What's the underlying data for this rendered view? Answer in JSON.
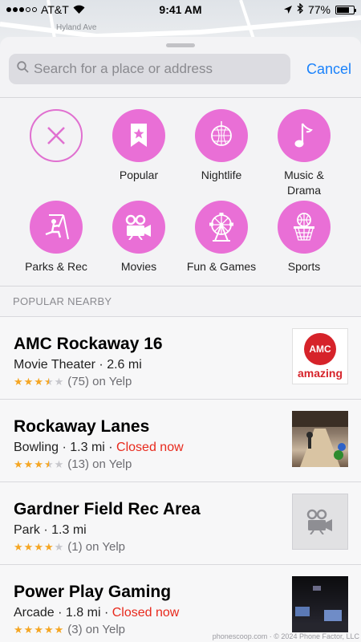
{
  "status": {
    "carrier": "AT&T",
    "time": "9:41 AM",
    "battery": "77%",
    "battery_level": 0.77
  },
  "map": {
    "street_label": "Hyland Ave"
  },
  "search": {
    "placeholder": "Search for a place or address",
    "cancel_label": "Cancel"
  },
  "categories": [
    {
      "label": "",
      "icon": "close-icon"
    },
    {
      "label": "Popular",
      "icon": "bookmark-star-icon"
    },
    {
      "label": "Nightlife",
      "icon": "disco-ball-icon"
    },
    {
      "label": "Music &\nDrama",
      "icon": "music-note-icon"
    },
    {
      "label": "Parks & Rec",
      "icon": "swing-icon"
    },
    {
      "label": "Movies",
      "icon": "film-camera-icon"
    },
    {
      "label": "Fun & Games",
      "icon": "ferris-wheel-icon"
    },
    {
      "label": "Sports",
      "icon": "basketball-hoop-icon"
    }
  ],
  "section": {
    "title": "POPULAR NEARBY"
  },
  "places": [
    {
      "name": "AMC Rockaway 16",
      "type": "Movie Theater",
      "distance": "2.6 mi",
      "status": "",
      "stars": 3.5,
      "reviews": "(75) on Yelp",
      "thumb": {
        "logo": "amc",
        "tagline": "amazing"
      }
    },
    {
      "name": "Rockaway Lanes",
      "type": "Bowling",
      "distance": "1.3 mi",
      "status": "Closed now",
      "stars": 3.5,
      "reviews": "(13) on Yelp",
      "thumb": {
        "kind": "photo"
      }
    },
    {
      "name": "Gardner Field Rec Area",
      "type": "Park",
      "distance": "1.3 mi",
      "status": "",
      "stars": 4,
      "reviews": "(1) on Yelp",
      "thumb": {
        "kind": "placeholder-film-camera"
      }
    },
    {
      "name": "Power Play Gaming",
      "type": "Arcade",
      "distance": "1.8 mi",
      "status": "Closed now",
      "stars": 5,
      "reviews": "(3) on Yelp",
      "thumb": {
        "kind": "photo"
      }
    }
  ],
  "colors": {
    "accent": "#1a82fb",
    "category": "#e96fd6",
    "closed": "#e8291c",
    "star": "#f5a623"
  },
  "watermark": "phonescoop.com · © 2024 Phone Factor, LLC"
}
